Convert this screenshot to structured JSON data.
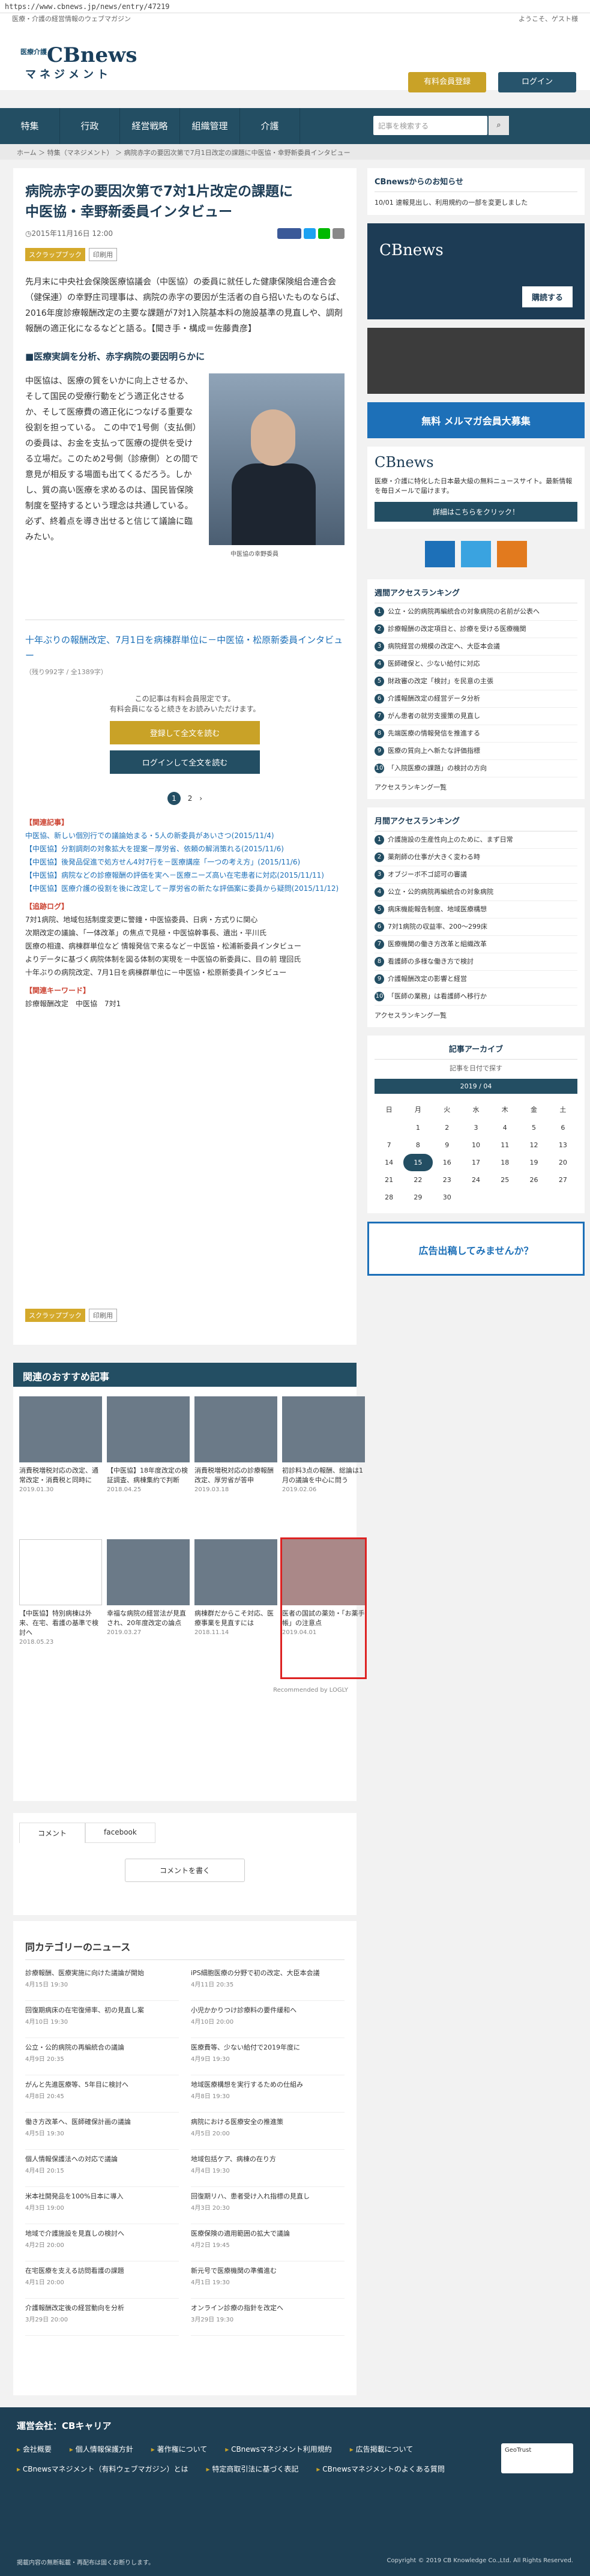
{
  "url": "https://www.cbnews.jp/news/entry/47219",
  "topline": {
    "left": "医療・介護の経営情報のウェブマガジン",
    "right": "ようこそ、ゲスト様"
  },
  "brand": {
    "small": "医療介護",
    "name": "CBnews",
    "sub": "マネジメント"
  },
  "header": {
    "trial": "有料会員登録",
    "login": "ログイン"
  },
  "nav": [
    "特集",
    "行政",
    "経営戦略",
    "組織管理",
    "介護"
  ],
  "search": {
    "placeholder": "記事を検索する"
  },
  "breadcrumb": "ホーム ＞ 特集（マネジメント） ＞ 病院赤字の要因次第で7月1日改定の課題に中医協・幸野新委員インタビュー",
  "article": {
    "title": "病院赤字の要因次第で7対1片改定の課題に\n中医協・幸野新委員インタビュー",
    "date": "2015年11月16日 12:00",
    "tag": "スクラップブック",
    "print": "印刷用",
    "lead": "先月末に中央社会保険医療協議会（中医協）の委員に就任した健康保険組合連合会（健保連）の幸野庄司理事は、病院の赤字の要因が生活者の自ら招いたものならば、2016年度診療報酬改定の主要な課題が7対1入院基本料の施設基準の見直しや、調剤報酬の適正化になるなどと語る。【聞き手・構成＝佐藤貴彦】",
    "section": "■医療実調を分析、赤字病院の要因明らかに",
    "body": "中医協は、医療の質をいかに向上させるか、そして国民の受療行動をどう適正化させるか、そして医療費の適正化につなげる重要な役割を担っている。 この中で1号側（支払側）の委員は、お金を支払って医療の提供を受ける立場だ。このため2号側（診療側）との間で意見が相反する場面も出てくるだろう。しかし、質の高い医療を求めるのは、国民皆保険制度を堅持するという理念は共通している。必ず、終着点を導き出せると信じて議論に臨みたい。",
    "caption": "中医協の幸野委員",
    "next": "十年ぶりの報酬改定、7月1日を病棟群単位に－中医協・松原新委員インタビュー",
    "chars": "（残り992字 / 全1389字）",
    "lock_msg1": "この記事は有料会員限定です。",
    "lock_msg2": "有料会員になると続きをお読みいただけます。",
    "register": "登録して全文を読む",
    "login_read": "ログインして全文を読む"
  },
  "related": {
    "head1": "【関連記事】",
    "items": [
      "中医協、新しい個別行での議論始まる・5人の新委員があいさつ(2015/11/4)",
      "【中医協】分割調剤の対象拡大を提案－厚労省、依頼の解消策れる(2015/11/6)",
      "【中医協】後発品促進で処方せん4対7行を－医療講座「一つの考え方」(2015/11/6)",
      "【中医協】病院などの診療報酬の評価を実へ－医療ニーズ高い在宅患者に対応(2015/11/11)",
      "【中医協】医療介護の役割を後に改定して－厚労省の新たな評価案に委員から疑問(2015/11/12)"
    ],
    "head2": "【追跡ログ】",
    "items2": [
      "7対1病院、地域包括制度変更に警鐘・中医協委員、日病・方式りに関心",
      "次期改定の議論、「一体改革」の焦点で見極・中医協幹事長、遺出・平川氏",
      "医療の相違、病棟群単位など 情報発信で来るなど－中医協・松浦新委員インタビュー",
      "よりデータに基づく病院体制を図る体制の実現を－中医協の新委員に、目の前 理回氏",
      "十年ぶりの病院改定、7月1日を病棟群単位に－中医協・松原新委員インタビュー"
    ],
    "head3": "【関連キーワード】",
    "keywords": "診療報酬改定　中医協　7対1"
  },
  "pager": {
    "current": "1",
    "next": "2"
  },
  "recommend": {
    "title": "関連のおすすめ記事",
    "items": [
      {
        "t": "消費税増税対応の改定、通常改定・消費税と同時に",
        "d": "2019.01.30"
      },
      {
        "t": "【中医協】18年度改定の検証調査、病棟集約で判断",
        "d": "2018.04.25"
      },
      {
        "t": "消費税増税対応の診療報酬改定、厚労省が答申",
        "d": "2019.03.18"
      },
      {
        "t": "初診料3点の報酬、総論は1月の議論を中心に問う",
        "d": "2019.02.06"
      },
      {
        "t": "【中医協】特別病棟は外来、在宅、看護の基準で検討へ",
        "d": "2018.05.23"
      },
      {
        "t": "幸福な病院の経営法が見直され、20年度改定の論点",
        "d": "2019.03.27"
      },
      {
        "t": "病棟群だからこそ対応、医療事業を見直すには",
        "d": "2018.11.14"
      },
      {
        "t": "医者の国試の薬効・「お薬手帳」の注意点",
        "d": "2019.04.01"
      }
    ],
    "powered": "Recommended by LOGLY"
  },
  "comments": {
    "tab1": "コメント",
    "tab2": "facebook",
    "write": "コメントを書く"
  },
  "category": {
    "title": "同カテゴリーのニュース",
    "items": [
      {
        "t": "診療報酬、医療実施に向けた議論が開始",
        "d": "4月15日 19:30"
      },
      {
        "t": "iPS細胞医療の分野で初の改定、大臣本会議",
        "d": "4月11日 20:35"
      },
      {
        "t": "回復期病床の在宅復帰率、初の見直し案",
        "d": "4月10日 19:30"
      },
      {
        "t": "小児かかりつけ診療料の要件緩和へ",
        "d": "4月10日 20:00"
      },
      {
        "t": "公立・公的病院の再編統合の議論",
        "d": "4月9日 20:35"
      },
      {
        "t": "医療費等、少ない給付で2019年度に",
        "d": "4月9日 19:30"
      },
      {
        "t": "がんと先進医療等、5年目に検討へ",
        "d": "4月8日 20:45"
      },
      {
        "t": "地域医療構想を実行するための仕組み",
        "d": "4月8日 19:30"
      },
      {
        "t": "働き方改革へ、医師確保計画の議論",
        "d": "4月5日 19:30"
      },
      {
        "t": "病院における医療安全の推進策",
        "d": "4月5日 20:00"
      },
      {
        "t": "個人情報保護法への対応で議論",
        "d": "4月4日 20:15"
      },
      {
        "t": "地域包括ケア、病棟の在り方",
        "d": "4月4日 19:30"
      },
      {
        "t": "米本社開発品を100%日本に導入",
        "d": "4月3日 19:00"
      },
      {
        "t": "回復期リハ、患者受け入れ指標の見直し",
        "d": "4月3日 20:30"
      },
      {
        "t": "地域で介護施設を見直しの検討へ",
        "d": "4月2日 20:00"
      },
      {
        "t": "医療保険の適用範囲の拡大で議論",
        "d": "4月2日 19:45"
      },
      {
        "t": "在宅医療を支える訪問看護の課題",
        "d": "4月1日 20:00"
      },
      {
        "t": "新元号で医療機関の準備進む",
        "d": "4月1日 19:30"
      },
      {
        "t": "介護報酬改定後の経営動向を分析",
        "d": "3月29日 20:00"
      },
      {
        "t": "オンライン診療の指針を改定へ",
        "d": "3月29日 19:30"
      }
    ]
  },
  "sidebar": {
    "notice_title": "CBnewsからのお知らせ",
    "notice": "10/01 速報見出し、利用規約の一部を変更しました",
    "buy": "購読する",
    "mail_banner": "無料 メルマガ会員大募集",
    "services_text": "医療・介護に特化した日本最大級の無料ニュースサイト。最新情報を毎日メールで届けます。",
    "services_btn": "詳細はこちらをクリック！",
    "weekly_title": "週間アクセスランキング",
    "weekly": [
      "公立・公的病院再編統合の対象病院の名前が公表へ",
      "診療報酬の改定項目と、診療を受ける医療機関",
      "病院経営の規模の改定へ、大臣本会議",
      "医師確保と、少ない給付に対応",
      "財政審の改定「検討」を民意の主張",
      "介護報酬改定の経営データ分析",
      "がん患者の就労支援策の見直し",
      "先端医療の情報発信を推進する",
      "医療の質向上へ新たな評価指標",
      "「入院医療の課題」の検討の方向"
    ],
    "weekly_more": "アクセスランキング一覧",
    "monthly_title": "月間アクセスランキング",
    "monthly": [
      "介護施設の生産性向上のために、まず日常",
      "薬剤師の仕事が大きく変わる時",
      "オブジーボ不ゴ認可の審議",
      "公立・公的病院再編統合の対象病院",
      "病床機能報告制度、地域医療構想",
      "7対1病院の収益率、200～299床",
      "医療機関の働き方改革と組織改革",
      "看護師の多様な働き方で検討",
      "介護報酬改定の影響と経営",
      "「医師の業務」は看護師へ移行か"
    ],
    "monthly_more": "アクセスランキング一覧",
    "archive_title": "記事アーカイブ",
    "archive_sub": "記事を日付で探す",
    "month": "2019 / 04",
    "wdays": [
      "日",
      "月",
      "火",
      "水",
      "木",
      "金",
      "土"
    ],
    "days": [
      "",
      "1",
      "2",
      "3",
      "4",
      "5",
      "6",
      "7",
      "8",
      "9",
      "10",
      "11",
      "12",
      "13",
      "14",
      "15",
      "16",
      "17",
      "18",
      "19",
      "20",
      "21",
      "22",
      "23",
      "24",
      "25",
      "26",
      "27",
      "28",
      "29",
      "30",
      "",
      "",
      "",
      ""
    ],
    "today": "15",
    "ad_banner": "広告出稿してみませんか？"
  },
  "footer": {
    "company": "運営会社：CBキャリア",
    "links": [
      "会社概要",
      "個人情報保護方針",
      "著作権について",
      "CBnewsマネジメント利用規約",
      "広告掲載について",
      "CBnewsマネジメント（有料ウェブマガジン）とは",
      "特定商取引法に基づく表記",
      "CBnewsマネジメントのよくある質問"
    ],
    "note": "掲載内容の無断転載・再配布は固くお断りします。",
    "copy": "Copyright © 2019 CB Knowledge Co.,Ltd. All Rights Reserved.",
    "trust": "GeoTrust"
  }
}
